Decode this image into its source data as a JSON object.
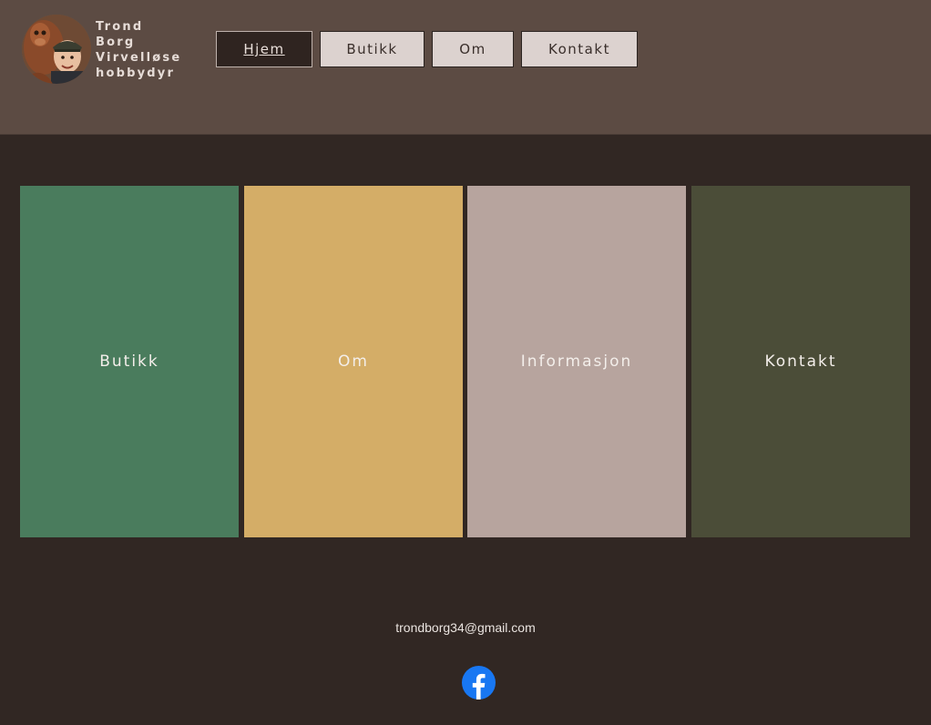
{
  "site": {
    "title_lines": [
      "Trond",
      "Borg",
      "Virvelløse",
      "hobbydyr"
    ]
  },
  "nav": [
    {
      "label": "Hjem",
      "active": true
    },
    {
      "label": "Butikk",
      "active": false
    },
    {
      "label": "Om",
      "active": false
    },
    {
      "label": "Kontakt",
      "active": false
    }
  ],
  "tiles": [
    {
      "label": "Butikk",
      "color": "#4a7c5d"
    },
    {
      "label": "Om",
      "color": "#d4ad67"
    },
    {
      "label": "Informasjon",
      "color": "#b7a49e"
    },
    {
      "label": "Kontakt",
      "color": "#4b4d38"
    }
  ],
  "footer": {
    "email": "trondborg34@gmail.com",
    "social_icon": "facebook-icon",
    "social_color": "#1877f2"
  },
  "colors": {
    "header_bg": "#5c4b43",
    "page_bg": "#312723"
  }
}
